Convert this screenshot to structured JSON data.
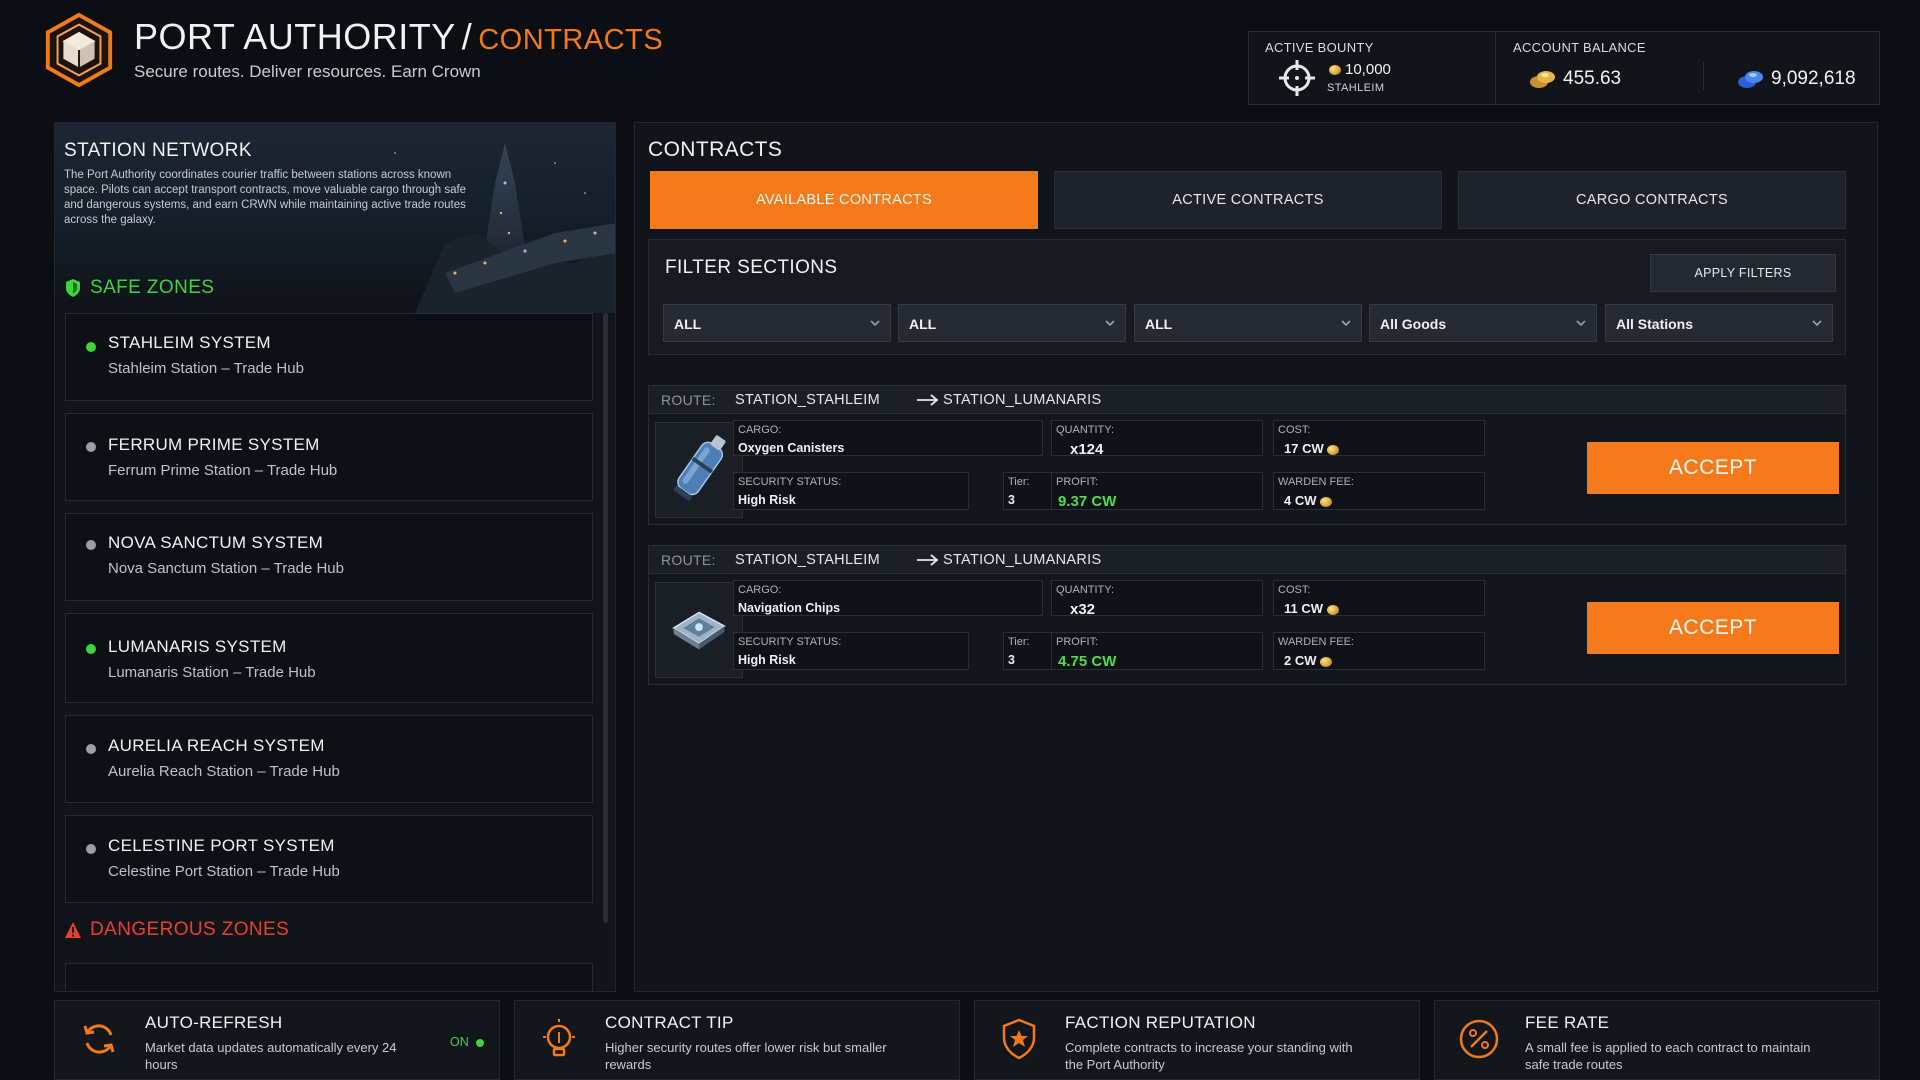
{
  "header": {
    "title": "PORT AUTHORITY",
    "separator": "/",
    "section": "CONTRACTS",
    "subtitle": "Secure routes. Deliver resources. Earn Crown"
  },
  "stats": {
    "bounty_label": "ACTIVE BOUNTY",
    "bounty_amount": "10,000",
    "bounty_station": "STAHLEIM",
    "balance_label": "ACCOUNT BALANCE",
    "gold_balance": "455.63",
    "blue_balance": "9,092,618"
  },
  "sidebar": {
    "title": "STATION NETWORK",
    "description": "The Port Authority coordinates courier traffic between stations across known space. Pilots can accept transport contracts, move valuable cargo through safe and dangerous systems, and earn CRWN while maintaining active trade routes across the galaxy.",
    "safe_zones_label": "SAFE ZONES",
    "dangerous_zones_label": "DANGEROUS ZONES",
    "systems": [
      {
        "name": "STAHLEIM SYSTEM",
        "station": "Stahleim Station – Trade Hub",
        "status": "online"
      },
      {
        "name": "FERRUM PRIME SYSTEM",
        "station": "Ferrum Prime Station – Trade Hub",
        "status": "offline"
      },
      {
        "name": "NOVA SANCTUM SYSTEM",
        "station": "Nova Sanctum Station – Trade Hub",
        "status": "offline"
      },
      {
        "name": "LUMANARIS SYSTEM",
        "station": "Lumanaris Station – Trade Hub",
        "status": "online"
      },
      {
        "name": "AURELIA REACH SYSTEM",
        "station": "Aurelia Reach Station – Trade Hub",
        "status": "offline"
      },
      {
        "name": "CELESTINE PORT SYSTEM",
        "station": "Celestine Port Station – Trade Hub",
        "status": "offline"
      }
    ]
  },
  "main": {
    "title": "CONTRACTS",
    "tabs": [
      {
        "label": "AVAILABLE CONTRACTS",
        "active": true
      },
      {
        "label": "ACTIVE CONTRACTS",
        "active": false
      },
      {
        "label": "CARGO CONTRACTS",
        "active": false
      }
    ],
    "filters": {
      "title": "FILTER SECTIONS",
      "apply_label": "APPLY FILTERS",
      "selects": [
        "ALL",
        "ALL",
        "ALL",
        "All Goods",
        "All Stations"
      ]
    },
    "contracts": [
      {
        "route_label": "ROUTE:",
        "from": "STATION_STAHLEIM",
        "to": "STATION_LUMANARIS",
        "cargo_label": "CARGO:",
        "cargo": "Oxygen Canisters",
        "quantity_label": "QUANTITY:",
        "quantity": "x124",
        "cost_label": "COST:",
        "cost": "17 CW",
        "security_label": "SECURITY STATUS:",
        "security": "High Risk",
        "tier_label": "Tier:",
        "tier": "3",
        "profit_label": "PROFIT:",
        "profit": "9.37 CW",
        "fee_label": "WARDEN FEE:",
        "fee": "4 CW",
        "icon": "oxygen-canister-icon",
        "accept_label": "ACCEPT"
      },
      {
        "route_label": "ROUTE:",
        "from": "STATION_STAHLEIM",
        "to": "STATION_LUMANARIS",
        "cargo_label": "CARGO:",
        "cargo": "Navigation Chips",
        "quantity_label": "QUANTITY:",
        "quantity": "x32",
        "cost_label": "COST:",
        "cost": "11 CW",
        "security_label": "SECURITY STATUS:",
        "security": "High Risk",
        "tier_label": "Tier:",
        "tier": "3",
        "profit_label": "PROFIT:",
        "profit": "4.75 CW",
        "fee_label": "WARDEN FEE:",
        "fee": "2 CW",
        "icon": "navigation-chip-icon",
        "accept_label": "ACCEPT"
      }
    ]
  },
  "footer": [
    {
      "title": "AUTO-REFRESH",
      "text": "Market data updates automatically every 24 hours",
      "status": "ON",
      "icon": "refresh-icon"
    },
    {
      "title": "CONTRACT TIP",
      "text": "Higher security routes offer lower risk but smaller rewards",
      "icon": "lightbulb-icon"
    },
    {
      "title": "FACTION REPUTATION",
      "text": "Complete contracts to increase your standing with the Port Authority",
      "icon": "shield-star-icon"
    },
    {
      "title": "FEE RATE",
      "text": "A small fee is applied to each contract to maintain safe trade routes",
      "icon": "percent-icon"
    }
  ],
  "colors": {
    "accent": "#f47a1c",
    "safe": "#3fd33f",
    "danger": "#e8402e",
    "profit": "#4be04b",
    "background": "#0b0e12"
  }
}
